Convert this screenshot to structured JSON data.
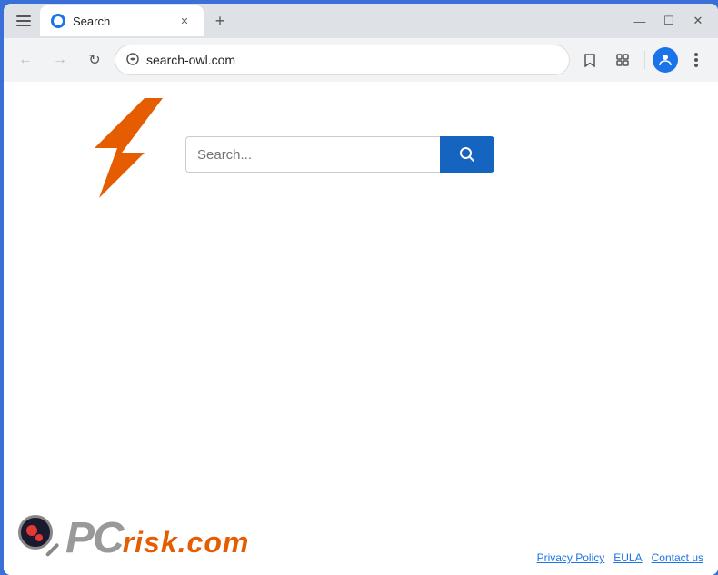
{
  "browser": {
    "tab": {
      "label": "Search",
      "favicon_color": "#1a73e8"
    },
    "new_tab_label": "+",
    "window_controls": {
      "minimize": "—",
      "maximize": "☐",
      "close": "✕"
    },
    "address_bar": {
      "url": "search-owl.com",
      "icon": "🔒"
    },
    "nav": {
      "back": "←",
      "forward": "→",
      "reload": "↻"
    }
  },
  "page": {
    "search_placeholder": "Search...",
    "search_button_icon": "🔍"
  },
  "footer": {
    "links": [
      {
        "label": "Privacy Policy"
      },
      {
        "label": "EULA"
      },
      {
        "label": "Contact us"
      }
    ],
    "logo": {
      "pc": "PC",
      "risk": "risk",
      "dot_com": ".com"
    }
  }
}
